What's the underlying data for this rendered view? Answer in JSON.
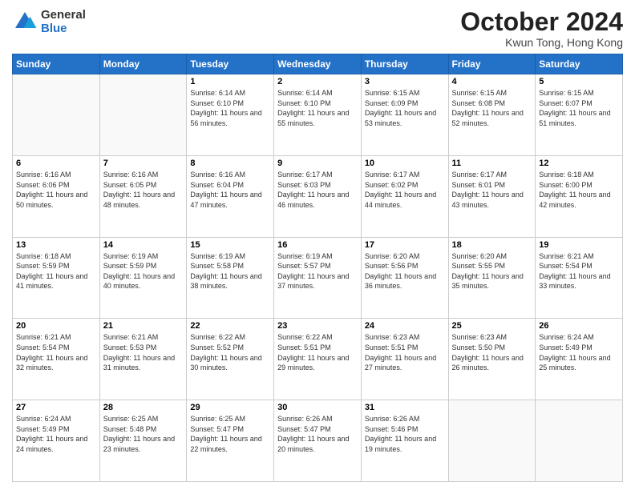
{
  "header": {
    "logo_general": "General",
    "logo_blue": "Blue",
    "month_title": "October 2024",
    "location": "Kwun Tong, Hong Kong"
  },
  "days_of_week": [
    "Sunday",
    "Monday",
    "Tuesday",
    "Wednesday",
    "Thursday",
    "Friday",
    "Saturday"
  ],
  "weeks": [
    [
      {
        "date": "",
        "sunrise": "",
        "sunset": "",
        "daylight": ""
      },
      {
        "date": "",
        "sunrise": "",
        "sunset": "",
        "daylight": ""
      },
      {
        "date": "1",
        "sunrise": "Sunrise: 6:14 AM",
        "sunset": "Sunset: 6:10 PM",
        "daylight": "Daylight: 11 hours and 56 minutes."
      },
      {
        "date": "2",
        "sunrise": "Sunrise: 6:14 AM",
        "sunset": "Sunset: 6:10 PM",
        "daylight": "Daylight: 11 hours and 55 minutes."
      },
      {
        "date": "3",
        "sunrise": "Sunrise: 6:15 AM",
        "sunset": "Sunset: 6:09 PM",
        "daylight": "Daylight: 11 hours and 53 minutes."
      },
      {
        "date": "4",
        "sunrise": "Sunrise: 6:15 AM",
        "sunset": "Sunset: 6:08 PM",
        "daylight": "Daylight: 11 hours and 52 minutes."
      },
      {
        "date": "5",
        "sunrise": "Sunrise: 6:15 AM",
        "sunset": "Sunset: 6:07 PM",
        "daylight": "Daylight: 11 hours and 51 minutes."
      }
    ],
    [
      {
        "date": "6",
        "sunrise": "Sunrise: 6:16 AM",
        "sunset": "Sunset: 6:06 PM",
        "daylight": "Daylight: 11 hours and 50 minutes."
      },
      {
        "date": "7",
        "sunrise": "Sunrise: 6:16 AM",
        "sunset": "Sunset: 6:05 PM",
        "daylight": "Daylight: 11 hours and 48 minutes."
      },
      {
        "date": "8",
        "sunrise": "Sunrise: 6:16 AM",
        "sunset": "Sunset: 6:04 PM",
        "daylight": "Daylight: 11 hours and 47 minutes."
      },
      {
        "date": "9",
        "sunrise": "Sunrise: 6:17 AM",
        "sunset": "Sunset: 6:03 PM",
        "daylight": "Daylight: 11 hours and 46 minutes."
      },
      {
        "date": "10",
        "sunrise": "Sunrise: 6:17 AM",
        "sunset": "Sunset: 6:02 PM",
        "daylight": "Daylight: 11 hours and 44 minutes."
      },
      {
        "date": "11",
        "sunrise": "Sunrise: 6:17 AM",
        "sunset": "Sunset: 6:01 PM",
        "daylight": "Daylight: 11 hours and 43 minutes."
      },
      {
        "date": "12",
        "sunrise": "Sunrise: 6:18 AM",
        "sunset": "Sunset: 6:00 PM",
        "daylight": "Daylight: 11 hours and 42 minutes."
      }
    ],
    [
      {
        "date": "13",
        "sunrise": "Sunrise: 6:18 AM",
        "sunset": "Sunset: 5:59 PM",
        "daylight": "Daylight: 11 hours and 41 minutes."
      },
      {
        "date": "14",
        "sunrise": "Sunrise: 6:19 AM",
        "sunset": "Sunset: 5:59 PM",
        "daylight": "Daylight: 11 hours and 40 minutes."
      },
      {
        "date": "15",
        "sunrise": "Sunrise: 6:19 AM",
        "sunset": "Sunset: 5:58 PM",
        "daylight": "Daylight: 11 hours and 38 minutes."
      },
      {
        "date": "16",
        "sunrise": "Sunrise: 6:19 AM",
        "sunset": "Sunset: 5:57 PM",
        "daylight": "Daylight: 11 hours and 37 minutes."
      },
      {
        "date": "17",
        "sunrise": "Sunrise: 6:20 AM",
        "sunset": "Sunset: 5:56 PM",
        "daylight": "Daylight: 11 hours and 36 minutes."
      },
      {
        "date": "18",
        "sunrise": "Sunrise: 6:20 AM",
        "sunset": "Sunset: 5:55 PM",
        "daylight": "Daylight: 11 hours and 35 minutes."
      },
      {
        "date": "19",
        "sunrise": "Sunrise: 6:21 AM",
        "sunset": "Sunset: 5:54 PM",
        "daylight": "Daylight: 11 hours and 33 minutes."
      }
    ],
    [
      {
        "date": "20",
        "sunrise": "Sunrise: 6:21 AM",
        "sunset": "Sunset: 5:54 PM",
        "daylight": "Daylight: 11 hours and 32 minutes."
      },
      {
        "date": "21",
        "sunrise": "Sunrise: 6:21 AM",
        "sunset": "Sunset: 5:53 PM",
        "daylight": "Daylight: 11 hours and 31 minutes."
      },
      {
        "date": "22",
        "sunrise": "Sunrise: 6:22 AM",
        "sunset": "Sunset: 5:52 PM",
        "daylight": "Daylight: 11 hours and 30 minutes."
      },
      {
        "date": "23",
        "sunrise": "Sunrise: 6:22 AM",
        "sunset": "Sunset: 5:51 PM",
        "daylight": "Daylight: 11 hours and 29 minutes."
      },
      {
        "date": "24",
        "sunrise": "Sunrise: 6:23 AM",
        "sunset": "Sunset: 5:51 PM",
        "daylight": "Daylight: 11 hours and 27 minutes."
      },
      {
        "date": "25",
        "sunrise": "Sunrise: 6:23 AM",
        "sunset": "Sunset: 5:50 PM",
        "daylight": "Daylight: 11 hours and 26 minutes."
      },
      {
        "date": "26",
        "sunrise": "Sunrise: 6:24 AM",
        "sunset": "Sunset: 5:49 PM",
        "daylight": "Daylight: 11 hours and 25 minutes."
      }
    ],
    [
      {
        "date": "27",
        "sunrise": "Sunrise: 6:24 AM",
        "sunset": "Sunset: 5:49 PM",
        "daylight": "Daylight: 11 hours and 24 minutes."
      },
      {
        "date": "28",
        "sunrise": "Sunrise: 6:25 AM",
        "sunset": "Sunset: 5:48 PM",
        "daylight": "Daylight: 11 hours and 23 minutes."
      },
      {
        "date": "29",
        "sunrise": "Sunrise: 6:25 AM",
        "sunset": "Sunset: 5:47 PM",
        "daylight": "Daylight: 11 hours and 22 minutes."
      },
      {
        "date": "30",
        "sunrise": "Sunrise: 6:26 AM",
        "sunset": "Sunset: 5:47 PM",
        "daylight": "Daylight: 11 hours and 20 minutes."
      },
      {
        "date": "31",
        "sunrise": "Sunrise: 6:26 AM",
        "sunset": "Sunset: 5:46 PM",
        "daylight": "Daylight: 11 hours and 19 minutes."
      },
      {
        "date": "",
        "sunrise": "",
        "sunset": "",
        "daylight": ""
      },
      {
        "date": "",
        "sunrise": "",
        "sunset": "",
        "daylight": ""
      }
    ]
  ]
}
